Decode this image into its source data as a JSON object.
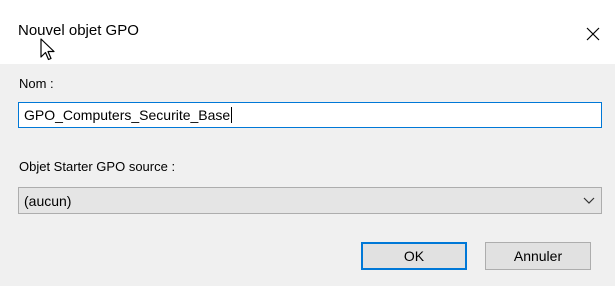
{
  "dialog": {
    "title": "Nouvel objet GPO",
    "close_icon": "close-icon",
    "cursor_icon": "mouse-pointer-icon"
  },
  "form": {
    "name_label": "Nom :",
    "name_value": "GPO_Computers_Securite_Base",
    "starter_label": "Objet Starter GPO source :",
    "starter_selected": "(aucun)",
    "starter_chevron_icon": "chevron-down-icon"
  },
  "buttons": {
    "ok_label": "OK",
    "cancel_label": "Annuler"
  },
  "colors": {
    "accent": "#0078d7",
    "body_bg": "#f0f0f0",
    "button_bg": "#e1e1e1"
  }
}
